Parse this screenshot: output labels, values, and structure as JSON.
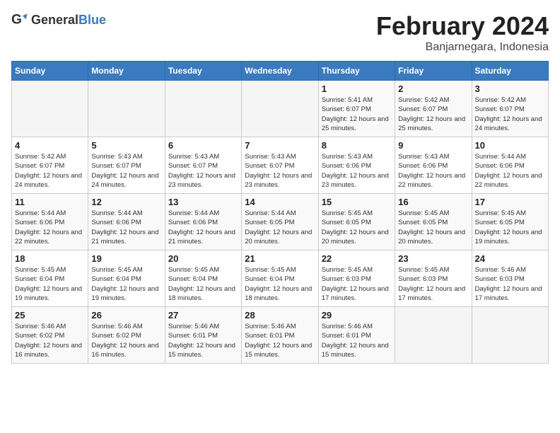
{
  "header": {
    "logo_general": "General",
    "logo_blue": "Blue",
    "title": "February 2024",
    "subtitle": "Banjarnegara, Indonesia"
  },
  "days_of_week": [
    "Sunday",
    "Monday",
    "Tuesday",
    "Wednesday",
    "Thursday",
    "Friday",
    "Saturday"
  ],
  "weeks": [
    [
      {
        "day": "",
        "empty": true
      },
      {
        "day": "",
        "empty": true
      },
      {
        "day": "",
        "empty": true
      },
      {
        "day": "",
        "empty": true
      },
      {
        "day": "1",
        "sunrise": "5:41 AM",
        "sunset": "6:07 PM",
        "daylight": "12 hours and 25 minutes."
      },
      {
        "day": "2",
        "sunrise": "5:42 AM",
        "sunset": "6:07 PM",
        "daylight": "12 hours and 25 minutes."
      },
      {
        "day": "3",
        "sunrise": "5:42 AM",
        "sunset": "6:07 PM",
        "daylight": "12 hours and 24 minutes."
      }
    ],
    [
      {
        "day": "4",
        "sunrise": "5:42 AM",
        "sunset": "6:07 PM",
        "daylight": "12 hours and 24 minutes."
      },
      {
        "day": "5",
        "sunrise": "5:43 AM",
        "sunset": "6:07 PM",
        "daylight": "12 hours and 24 minutes."
      },
      {
        "day": "6",
        "sunrise": "5:43 AM",
        "sunset": "6:07 PM",
        "daylight": "12 hours and 23 minutes."
      },
      {
        "day": "7",
        "sunrise": "5:43 AM",
        "sunset": "6:07 PM",
        "daylight": "12 hours and 23 minutes."
      },
      {
        "day": "8",
        "sunrise": "5:43 AM",
        "sunset": "6:06 PM",
        "daylight": "12 hours and 23 minutes."
      },
      {
        "day": "9",
        "sunrise": "5:43 AM",
        "sunset": "6:06 PM",
        "daylight": "12 hours and 22 minutes."
      },
      {
        "day": "10",
        "sunrise": "5:44 AM",
        "sunset": "6:06 PM",
        "daylight": "12 hours and 22 minutes."
      }
    ],
    [
      {
        "day": "11",
        "sunrise": "5:44 AM",
        "sunset": "6:06 PM",
        "daylight": "12 hours and 22 minutes."
      },
      {
        "day": "12",
        "sunrise": "5:44 AM",
        "sunset": "6:06 PM",
        "daylight": "12 hours and 21 minutes."
      },
      {
        "day": "13",
        "sunrise": "5:44 AM",
        "sunset": "6:06 PM",
        "daylight": "12 hours and 21 minutes."
      },
      {
        "day": "14",
        "sunrise": "5:44 AM",
        "sunset": "6:05 PM",
        "daylight": "12 hours and 20 minutes."
      },
      {
        "day": "15",
        "sunrise": "5:45 AM",
        "sunset": "6:05 PM",
        "daylight": "12 hours and 20 minutes."
      },
      {
        "day": "16",
        "sunrise": "5:45 AM",
        "sunset": "6:05 PM",
        "daylight": "12 hours and 20 minutes."
      },
      {
        "day": "17",
        "sunrise": "5:45 AM",
        "sunset": "6:05 PM",
        "daylight": "12 hours and 19 minutes."
      }
    ],
    [
      {
        "day": "18",
        "sunrise": "5:45 AM",
        "sunset": "6:04 PM",
        "daylight": "12 hours and 19 minutes."
      },
      {
        "day": "19",
        "sunrise": "5:45 AM",
        "sunset": "6:04 PM",
        "daylight": "12 hours and 19 minutes."
      },
      {
        "day": "20",
        "sunrise": "5:45 AM",
        "sunset": "6:04 PM",
        "daylight": "12 hours and 18 minutes."
      },
      {
        "day": "21",
        "sunrise": "5:45 AM",
        "sunset": "6:04 PM",
        "daylight": "12 hours and 18 minutes."
      },
      {
        "day": "22",
        "sunrise": "5:45 AM",
        "sunset": "6:03 PM",
        "daylight": "12 hours and 17 minutes."
      },
      {
        "day": "23",
        "sunrise": "5:45 AM",
        "sunset": "6:03 PM",
        "daylight": "12 hours and 17 minutes."
      },
      {
        "day": "24",
        "sunrise": "5:46 AM",
        "sunset": "6:03 PM",
        "daylight": "12 hours and 17 minutes."
      }
    ],
    [
      {
        "day": "25",
        "sunrise": "5:46 AM",
        "sunset": "6:02 PM",
        "daylight": "12 hours and 16 minutes."
      },
      {
        "day": "26",
        "sunrise": "5:46 AM",
        "sunset": "6:02 PM",
        "daylight": "12 hours and 16 minutes."
      },
      {
        "day": "27",
        "sunrise": "5:46 AM",
        "sunset": "6:01 PM",
        "daylight": "12 hours and 15 minutes."
      },
      {
        "day": "28",
        "sunrise": "5:46 AM",
        "sunset": "6:01 PM",
        "daylight": "12 hours and 15 minutes."
      },
      {
        "day": "29",
        "sunrise": "5:46 AM",
        "sunset": "6:01 PM",
        "daylight": "12 hours and 15 minutes."
      },
      {
        "day": "",
        "empty": true
      },
      {
        "day": "",
        "empty": true
      }
    ]
  ],
  "labels": {
    "sunrise_prefix": "Sunrise: ",
    "sunset_prefix": "Sunset: ",
    "daylight_prefix": "Daylight: "
  }
}
